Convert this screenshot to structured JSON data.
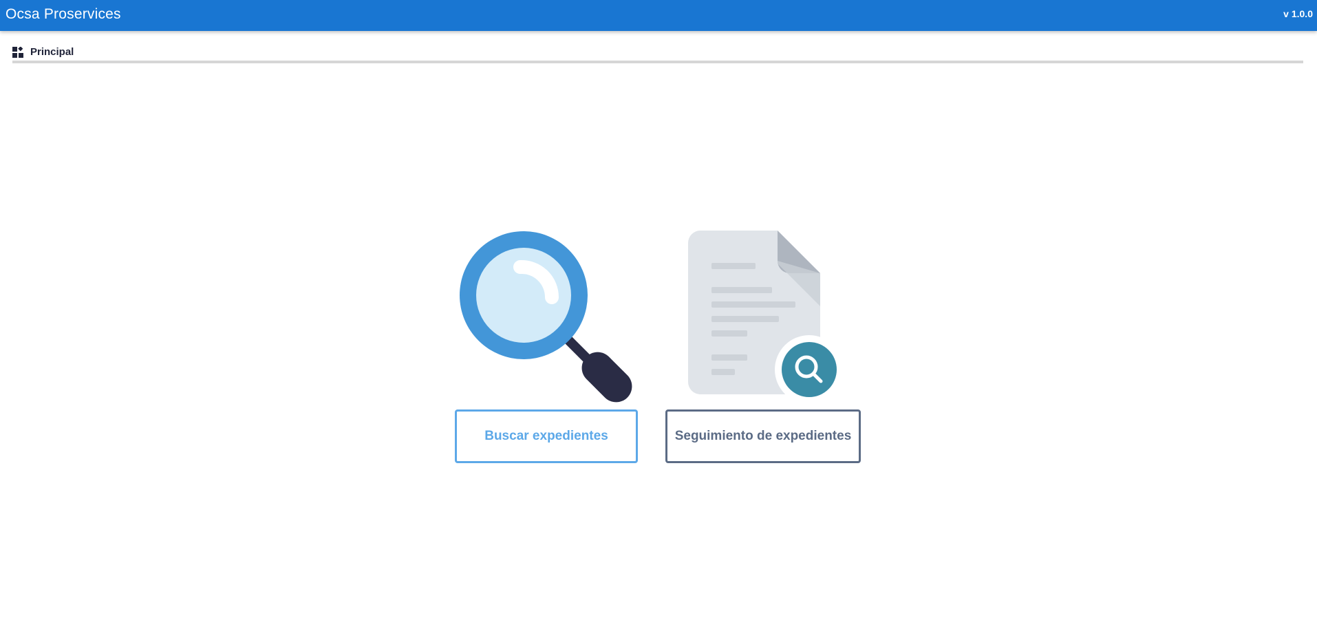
{
  "header": {
    "app_title": "Ocsa Proservices",
    "version": "v 1.0.0",
    "color": "#1976d2"
  },
  "breadcrumb": {
    "icon": "dashboard-icon",
    "label": "Principal"
  },
  "cards": [
    {
      "icon": "magnifying-glass-icon",
      "label": "Buscar expedientes",
      "color": "#5ca8e8"
    },
    {
      "icon": "document-search-icon",
      "label": "Seguimiento de expedientes",
      "color": "#5b6b85"
    }
  ]
}
